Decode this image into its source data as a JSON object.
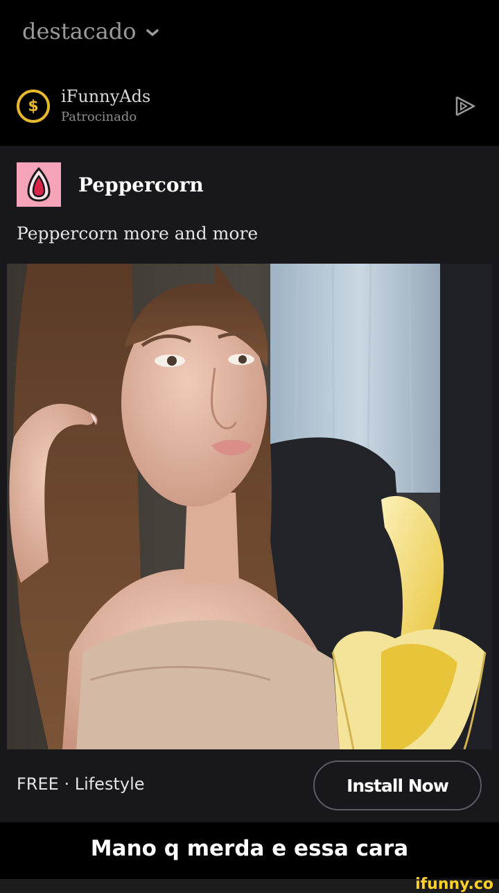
{
  "header": {
    "feed_title": "destacado",
    "chevron_icon": "chevron-down-icon"
  },
  "advertiser": {
    "name": "iFunnyAds",
    "label": "Patrocinado",
    "coin_symbol": "$",
    "coin_color": "#e8b92c",
    "play_icon": "play-outline-icon"
  },
  "ad": {
    "app_name": "Peppercorn",
    "app_icon": "peppercorn-logo-icon",
    "app_icon_bg": "#f4a3b8",
    "text": "Peppercorn more and more",
    "meta": "FREE · Lifestyle",
    "install_label": "Install Now"
  },
  "caption": "Mano q merda e essa cara",
  "watermark": "ifunny.co",
  "colors": {
    "background": "#000000",
    "card": "#17171c",
    "accent": "#ffd027"
  }
}
